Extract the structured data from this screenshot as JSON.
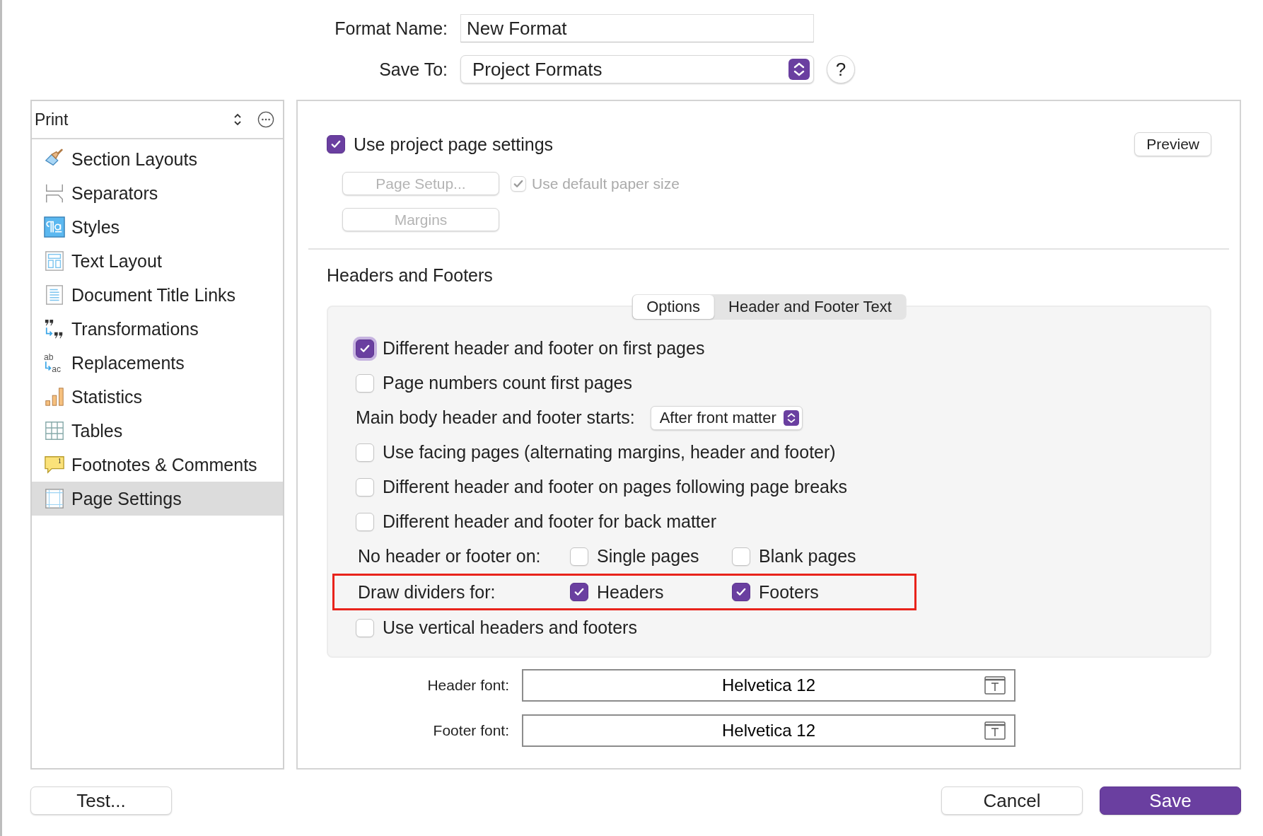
{
  "format_name": {
    "label": "Format Name:",
    "value": "New Format"
  },
  "save_to": {
    "label": "Save To:",
    "value": "Project Formats"
  },
  "help_button": "?",
  "sidebar": {
    "title": "Print",
    "items": [
      {
        "label": "Section Layouts",
        "kind": "brush",
        "selected": false
      },
      {
        "label": "Separators",
        "kind": "separator",
        "selected": false
      },
      {
        "label": "Styles",
        "kind": "styles",
        "selected": false
      },
      {
        "label": "Text Layout",
        "kind": "layout",
        "selected": false
      },
      {
        "label": "Document Title Links",
        "kind": "document",
        "selected": false
      },
      {
        "label": "Transformations",
        "kind": "quotes",
        "selected": false
      },
      {
        "label": "Replacements",
        "kind": "replace",
        "selected": false,
        "icon_text": [
          "ab",
          "ac"
        ]
      },
      {
        "label": "Statistics",
        "kind": "chart",
        "selected": false
      },
      {
        "label": "Tables",
        "kind": "table",
        "selected": false
      },
      {
        "label": "Footnotes & Comments",
        "kind": "footnote",
        "selected": false,
        "icon_text": [
          "1"
        ]
      },
      {
        "label": "Page Settings",
        "kind": "page",
        "selected": true
      }
    ]
  },
  "page_settings": {
    "use_project": {
      "label": "Use project page settings",
      "checked": true
    },
    "preview": "Preview",
    "page_setup": {
      "label": "Page Setup...",
      "disabled": true
    },
    "default_paper": {
      "label": "Use default paper size",
      "checked": true,
      "disabled": true
    },
    "margins": {
      "label": "Margins",
      "disabled": true
    }
  },
  "headers_footers": {
    "title": "Headers and Footers",
    "tabs": [
      {
        "label": "Options",
        "selected": true
      },
      {
        "label": "Header and Footer Text",
        "selected": false
      }
    ],
    "options": [
      {
        "kind": "checkbox",
        "label": "Different header and footer on first pages",
        "checked": true,
        "focused": true
      },
      {
        "kind": "checkbox",
        "label": "Page numbers count first pages",
        "checked": false,
        "focused": false
      },
      {
        "kind": "select",
        "label": "Main body header and footer starts:",
        "value": "After front matter"
      },
      {
        "kind": "checkbox",
        "label": "Use facing pages (alternating margins, header and footer)",
        "checked": false,
        "focused": false
      },
      {
        "kind": "checkbox",
        "label": "Different header and footer on pages following page breaks",
        "checked": false,
        "focused": false
      },
      {
        "kind": "checkbox",
        "label": "Different header and footer for back matter",
        "checked": false,
        "focused": false
      },
      {
        "kind": "group",
        "label": "No header or footer on:",
        "highlighted": false,
        "items": [
          {
            "label": "Single pages",
            "checked": false
          },
          {
            "label": "Blank pages",
            "checked": false
          }
        ]
      },
      {
        "kind": "group",
        "label": "Draw dividers for:",
        "highlighted": true,
        "items": [
          {
            "label": "Headers",
            "checked": true
          },
          {
            "label": "Footers",
            "checked": true
          }
        ]
      },
      {
        "kind": "checkbox",
        "label": "Use vertical headers and footers",
        "checked": false,
        "focused": false
      }
    ],
    "fonts": [
      {
        "label": "Header font:",
        "value": "Helvetica 12"
      },
      {
        "label": "Footer font:",
        "value": "Helvetica 12"
      }
    ]
  },
  "buttons": {
    "test": "Test...",
    "cancel": "Cancel",
    "save": "Save"
  }
}
